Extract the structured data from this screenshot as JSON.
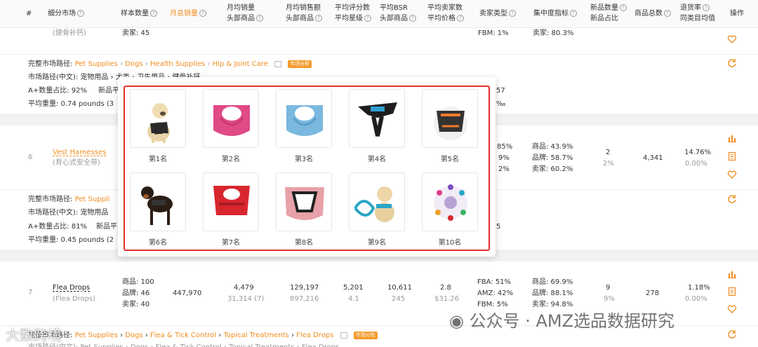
{
  "header": {
    "col_index": "#",
    "col_market": "细分市场",
    "col_sample": "样本数量",
    "col_total_sales": "月总销量",
    "col_avg_sales_1": "月均销量",
    "col_avg_sales_2": "头部商品",
    "col_avg_revenue_1": "月均销售额",
    "col_avg_revenue_2": "头部商品",
    "col_rating_1": "平均评分数",
    "col_rating_2": "平均星级",
    "col_bsr_1": "平均BSR",
    "col_bsr_2": "头部商品",
    "col_sellers_1": "平均卖家数",
    "col_sellers_2": "平均价格",
    "col_seller_type": "卖家类型",
    "col_concentration": "集中度指标",
    "col_new_1": "新品数量",
    "col_new_2": "新品占比",
    "col_total_products": "商品总数",
    "col_return_1": "退货率",
    "col_return_2": "同类目均值",
    "col_actions": "操作",
    "help_icon": "question-circle-icon"
  },
  "row_top": {
    "market_cn": "(健骨补钙)",
    "seller_count": "卖家: 45",
    "seller_type": "FBM: 1%",
    "concentration_seller": "卖家: 80.3%"
  },
  "detail_1": {
    "path_label": "完整市场路径:",
    "path": [
      "Pet Supplies",
      "Dogs",
      "Health Supplies",
      "Hip & Joint Care"
    ],
    "separator": "›",
    "tag": "市场分析",
    "path_cn": "市场路径(中文): 宠物用品 › 犬类 › 卫生用品 › 健骨补钙",
    "aplus_ratio": "A+数量占比: 92%",
    "new_products": "新品平",
    "avg_weight": "平均重量: 0.74 pounds (3",
    "right_partial_1": "57",
    "right_partial_2": "‰"
  },
  "row_6": {
    "index": "6",
    "market": "Vest Harnesses",
    "market_cn": "(背心式安全带)",
    "seller_type": [
      "85%",
      "9%",
      "2%"
    ],
    "concentration": [
      "商品: 43.9%",
      "品牌: 58.7%",
      "卖家: 60.2%"
    ],
    "new_count": "2",
    "new_ratio": "2%",
    "total_products": "4,341",
    "return_rate": "14.76%",
    "return_avg": "0.00%"
  },
  "detail_2": {
    "path_label": "完整市场路径:",
    "path_partial": "Pet Suppli",
    "path_cn": "市场路径(中文): 宠物用品",
    "aplus_ratio": "A+数量占比: 81%",
    "new_products": "新品平",
    "avg_weight": "平均重量: 0.45 pounds (2",
    "right_partial": "5"
  },
  "row_7": {
    "index": "7",
    "market": "Flea Drops",
    "market_cn": "(Flea Drops)",
    "sample": [
      "商品: 100",
      "品牌: 46",
      "卖家: 40"
    ],
    "total_sales": "447,970",
    "avg_sales": "4,479",
    "avg_sales_head": "31,314 (7)",
    "avg_revenue": "129,197",
    "avg_revenue_head": "897,216",
    "rating": "5,201",
    "rating_star": "4.1",
    "bsr": "10,611",
    "bsr_head": "245",
    "sellers": "2.8",
    "price": "$31.26",
    "seller_type": [
      "FBA: 51%",
      "AMZ: 42%",
      "FBM: 5%"
    ],
    "concentration": [
      "商品: 69.9%",
      "品牌: 88.1%",
      "卖家: 94.8%"
    ],
    "new_count": "9",
    "new_ratio": "9%",
    "total_products": "278",
    "return_rate": "1.18%",
    "return_avg": "0.00%"
  },
  "detail_3": {
    "path_label": "完整市场路径:",
    "path": [
      "Pet Supplies",
      "Dogs",
      "Flea & Tick Control",
      "Topical Treatments",
      "Flea Drops"
    ],
    "tag": "市场分析",
    "path_cn_partial": "市场路径(中文): Pet Supplies › Dogs › Flea & Tick Control › Topical Treatments › Flea Drops"
  },
  "popup": {
    "ranks": [
      "第1名",
      "第2名",
      "第3名",
      "第4名",
      "第5名",
      "第6名",
      "第7名",
      "第8名",
      "第9名",
      "第10名"
    ]
  },
  "watermark": {
    "main": "公众号 · AMZ选品数据研究",
    "corner": "大数跨境"
  },
  "colors": {
    "accent": "#f08c1e",
    "highlight_border": "#e0322b",
    "tag_bg": "#f39a2b"
  }
}
